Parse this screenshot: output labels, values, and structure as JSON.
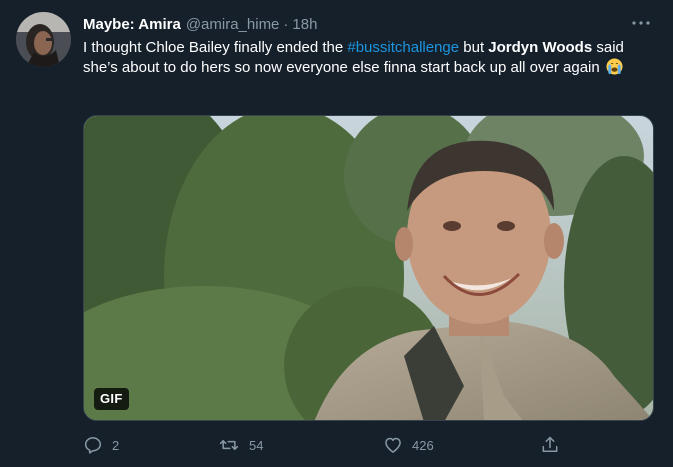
{
  "tweet": {
    "display_name": "Maybe: Amira",
    "handle": "@amira_hime",
    "separator": "·",
    "timestamp": "18h",
    "text": {
      "part1": "I thought Chloe Bailey finally ended the ",
      "hashtag": "#bussitchallenge",
      "part2": " but ",
      "bold_name": "Jordyn Woods",
      "part3": " said she’s about to do hers so now everyone else finna start back up all over again"
    },
    "media": {
      "badge": "GIF"
    },
    "actions": {
      "reply_count": "2",
      "retweet_count": "54",
      "like_count": "426"
    }
  },
  "icons": {
    "more": "more-horizontal-icon",
    "reply": "reply-bubble-icon",
    "retweet": "retweet-icon",
    "like": "heart-icon",
    "share": "share-upload-icon",
    "emoji": "crying-face-emoji-icon"
  },
  "colors": {
    "background": "#15202b",
    "text": "#ffffff",
    "secondary": "#8899a6",
    "link": "#1b95e0"
  }
}
